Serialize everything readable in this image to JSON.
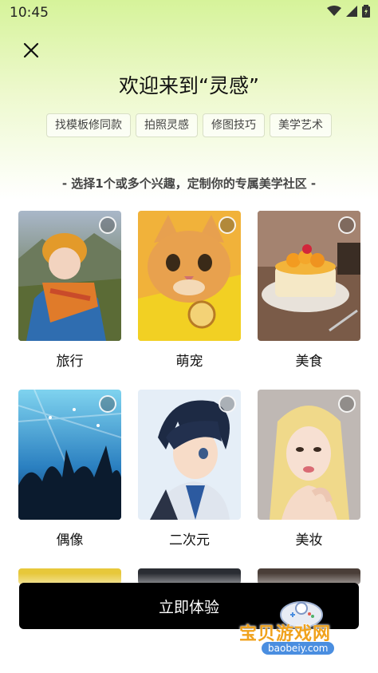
{
  "status_bar": {
    "time": "10:45"
  },
  "header": {
    "title": "欢迎来到“灵感”"
  },
  "tags": [
    "找模板修同款",
    "拍照灵感",
    "修图技巧",
    "美学艺术"
  ],
  "subtitle": "- 选择1个或多个兴趣，定制你的专属美学社区 -",
  "interests": [
    {
      "label": "旅行",
      "selected": false
    },
    {
      "label": "萌宠",
      "selected": false
    },
    {
      "label": "美食",
      "selected": false
    },
    {
      "label": "偶像",
      "selected": false
    },
    {
      "label": "二次元",
      "selected": false
    },
    {
      "label": "美妆",
      "selected": false
    }
  ],
  "cta": {
    "label": "立即体验"
  },
  "watermark": {
    "text": "宝贝游戏网",
    "url": "baobeiy.com"
  },
  "colors": {
    "gradient_top": "#d6f39a",
    "button_bg": "#000000",
    "watermark": "#f0a21c"
  }
}
